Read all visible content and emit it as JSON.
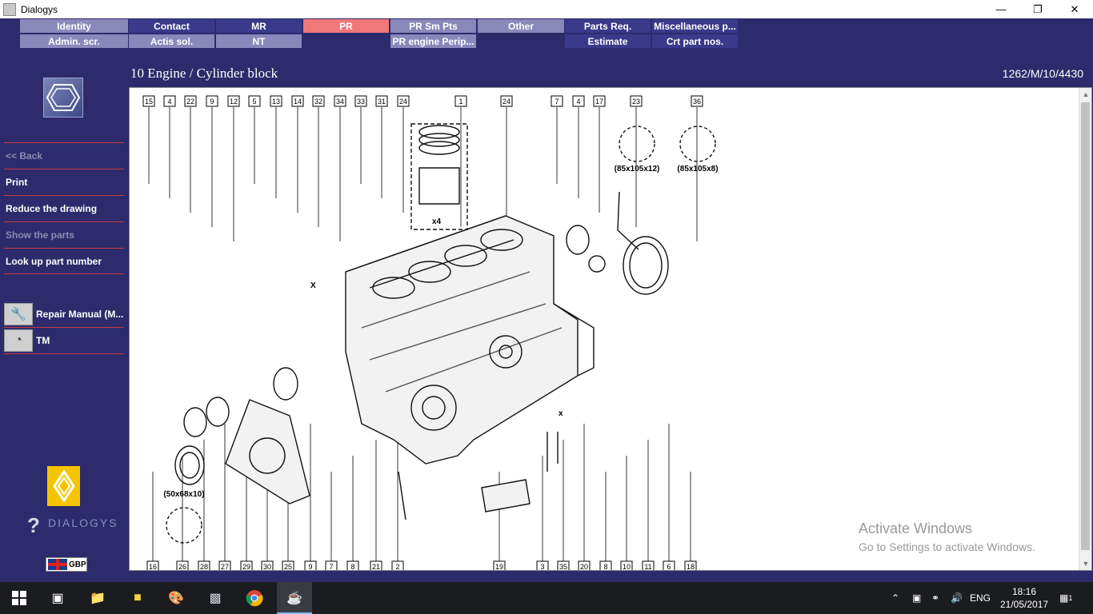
{
  "window": {
    "title": "Dialogys"
  },
  "tabs": {
    "row1": [
      "Identity",
      "Contact",
      "MR",
      "PR",
      "PR Sm Pts",
      "Other",
      "Parts Req.",
      "Miscellaneous p..."
    ],
    "row2": [
      "Admin. scr.",
      "Actis sol.",
      "NT",
      "PR engine Perip...",
      "Estimate",
      "Crt part nos."
    ]
  },
  "page": {
    "title": "10 Engine / Cylinder block",
    "ref": "1262/M/10/4430"
  },
  "sidebar": {
    "menu": [
      "<< Back",
      "Print",
      "Reduce the drawing",
      "Show the parts",
      "Look up part number"
    ],
    "apps": [
      "Repair Manual (M...",
      "TM"
    ],
    "brand": "DIALOGYS",
    "currency": "GBP"
  },
  "drawing": {
    "callouts_top": [
      "15",
      "4",
      "22",
      "9",
      "12",
      "5",
      "13",
      "14",
      "32",
      "34",
      "33",
      "31",
      "24",
      "1",
      "24",
      "7",
      "4",
      "17",
      "23",
      "36"
    ],
    "callouts_bottom": [
      "16",
      "26",
      "28",
      "27",
      "29",
      "30",
      "25",
      "9",
      "7",
      "8",
      "21",
      "2",
      "19",
      "3",
      "35",
      "20",
      "8",
      "10",
      "11",
      "6",
      "18"
    ],
    "seal_labels": [
      "(85x105x12)",
      "(85x105x8)",
      "(50x68x10)"
    ],
    "multiplier": "x4",
    "cross_marks": [
      "X",
      "x"
    ]
  },
  "watermark": {
    "line1": "Activate Windows",
    "line2": "Go to Settings to activate Windows."
  },
  "taskbar": {
    "lang": "ENG",
    "time": "18:16",
    "date": "21/05/2017",
    "notifications": "1"
  },
  "colors": {
    "background": "#2d2b6b",
    "tab_active": "#f17878",
    "tab_light": "#8a88bb",
    "tab_dark": "#3b398a",
    "separator": "#c73a45"
  }
}
